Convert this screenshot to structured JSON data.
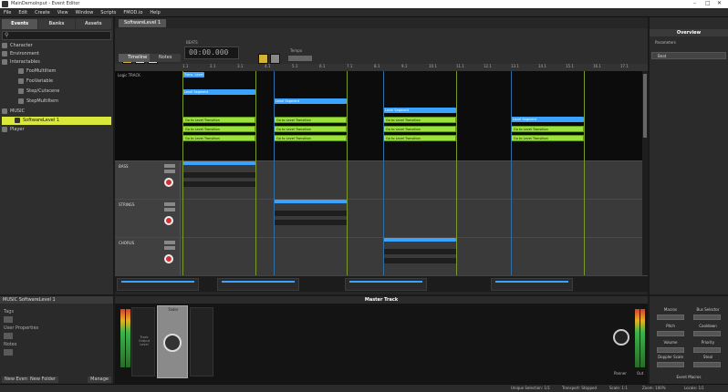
{
  "window": {
    "title": "MainDemoInput - Event Editor"
  },
  "menu": [
    "File",
    "Edit",
    "Create",
    "View",
    "Window",
    "Scripts",
    "FMOD.io",
    "Help"
  ],
  "left_panel": {
    "tabs": [
      "Events",
      "Banks",
      "Assets"
    ],
    "tree": [
      {
        "label": "Character",
        "indent": 0
      },
      {
        "label": "Environment",
        "indent": 0
      },
      {
        "label": "Interactables",
        "indent": 0
      },
      {
        "label": "FooMultiItem",
        "indent": 2
      },
      {
        "label": "FooVariable",
        "indent": 2
      },
      {
        "label": "Step/Cutscene",
        "indent": 2
      },
      {
        "label": "StepMultiItem",
        "indent": 2
      },
      {
        "label": "MUSIC",
        "indent": 0
      },
      {
        "label": "SoftwareLevel 1",
        "indent": 1,
        "selected": true
      },
      {
        "label": "Player",
        "indent": 0
      }
    ]
  },
  "props": {
    "header": "MUSIC SoftwareLevel 1",
    "labels": [
      "Tags",
      "User Properties",
      "Notes"
    ],
    "footer_left": "New Event",
    "footer_mid": "New Folder",
    "footer_right": "Manage"
  },
  "editor": {
    "tab": "SoftwareLevel 1",
    "timecode": "00:00.000",
    "timecode_prefix": "BEATS",
    "subtabs": [
      "Timeline",
      "Notes"
    ],
    "tempo_label": "Tempo",
    "ruler": [
      "1.1",
      "2.1",
      "3.1",
      "4.1",
      "5.1",
      "6.1",
      "7.1",
      "8.1",
      "9.1",
      "10.1",
      "11.1",
      "12.1",
      "13.1",
      "14.1",
      "15.1",
      "16.1",
      "17.1"
    ],
    "logic_track": "Logic TRACK",
    "tracks": [
      "BASS",
      "STRINGS",
      "CHORUS",
      "PERCUSS"
    ],
    "marker_label": "Trans. Level",
    "green_label": "Go to Level Transition",
    "blue_label": "Level Segment"
  },
  "right_panel": {
    "header": "Overview",
    "sub": "Parameters",
    "field": "Beat"
  },
  "master": {
    "header": "Master Track",
    "fader_label": "Fader",
    "left_label": "Track Output Level",
    "pan_label": "Panner",
    "out_label": "Out"
  },
  "right_bottom": {
    "items": [
      "Macros",
      "Bus Selector",
      "Pitch",
      "Cooldown",
      "Volume",
      "Priority",
      "Doppler Scale",
      "Steal",
      "Stealing Mode",
      "Limit",
      "Event Macros"
    ]
  },
  "status": [
    "Unique Selection: 1/1",
    "Transport: Stopped",
    "Scale: 1:1",
    "Zoom: 100%",
    "Locale: 1/1"
  ]
}
